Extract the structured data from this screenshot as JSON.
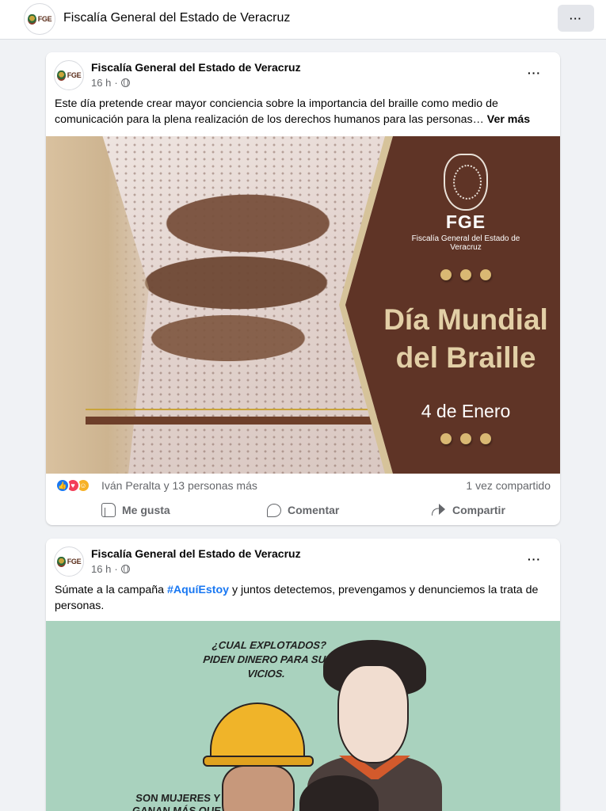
{
  "page": {
    "title": "Fiscalía General del Estado de Veracruz",
    "logo_text": "FGE",
    "more_label": "···"
  },
  "posts": [
    {
      "author": "Fiscalía General del Estado de Veracruz",
      "time": "16 h",
      "separator": "·",
      "more_label": "···",
      "text": "Este día pretende crear mayor conciencia sobre la importancia del braille como medio de comunicación para la plena realización de los derechos humanos para las personas…",
      "see_more": "Ver más",
      "image": {
        "org_short": "FGE",
        "org_name": "Fiscalía General del Estado de Veracruz",
        "headline": "Día Mundial del Braille",
        "date": "4 de Enero"
      },
      "reactions": {
        "icons": [
          "like-icon",
          "love-icon",
          "care-icon"
        ],
        "text": "Iván Peralta y 13 personas más",
        "shares": "1 vez compartido"
      },
      "actions": {
        "like": "Me gusta",
        "comment": "Comentar",
        "share": "Compartir"
      }
    },
    {
      "author": "Fiscalía General del Estado de Veracruz",
      "time": "16 h",
      "separator": "·",
      "more_label": "···",
      "text_before": "Súmate a la campaña ",
      "hashtag": "#AquíEstoy",
      "text_after": " y juntos detectemos, prevengamos y denunciemos la trata de personas.",
      "image": {
        "caption_top": "¿CUAL EXPLOTADOS? PIDEN DINERO PARA SUS VICIOS.",
        "caption_bottom": "SON MUJERES Y GANAN MÁS QUE YO"
      }
    }
  ]
}
